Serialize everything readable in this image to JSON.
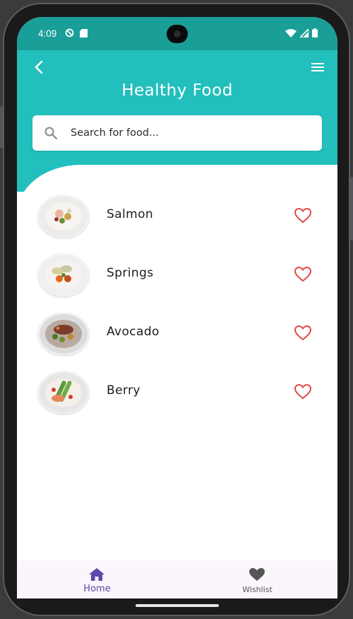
{
  "status_bar": {
    "time": "4:09",
    "icons_left": [
      "do-not-disturb-icon",
      "sim-card-icon"
    ],
    "icons_right": [
      "wifi-icon",
      "signal-icon",
      "battery-icon"
    ]
  },
  "header": {
    "title": "Healthy Food",
    "back_icon": "arrow-back-icon",
    "menu_icon": "hamburger-menu-icon"
  },
  "search": {
    "placeholder": "Search for food..."
  },
  "food_list": [
    {
      "name": "Salmon",
      "favorite_icon": "heart-outline-icon"
    },
    {
      "name": "Springs",
      "favorite_icon": "heart-outline-icon"
    },
    {
      "name": "Avocado",
      "favorite_icon": "heart-outline-icon"
    },
    {
      "name": "Berry",
      "favorite_icon": "heart-outline-icon"
    }
  ],
  "bottom_nav": {
    "items": [
      {
        "label": "Home",
        "icon": "home-icon",
        "selected": true
      },
      {
        "label": "Wishlist",
        "icon": "heart-filled-icon",
        "selected": false
      }
    ]
  },
  "colors": {
    "header_teal": "#22bfbd",
    "status_bar_teal": "#1a9e98",
    "heart_red": "#e04a42",
    "nav_selected": "#5b4aa6",
    "nav_unselected": "#555555",
    "nav_background": "#fbf5fc"
  }
}
